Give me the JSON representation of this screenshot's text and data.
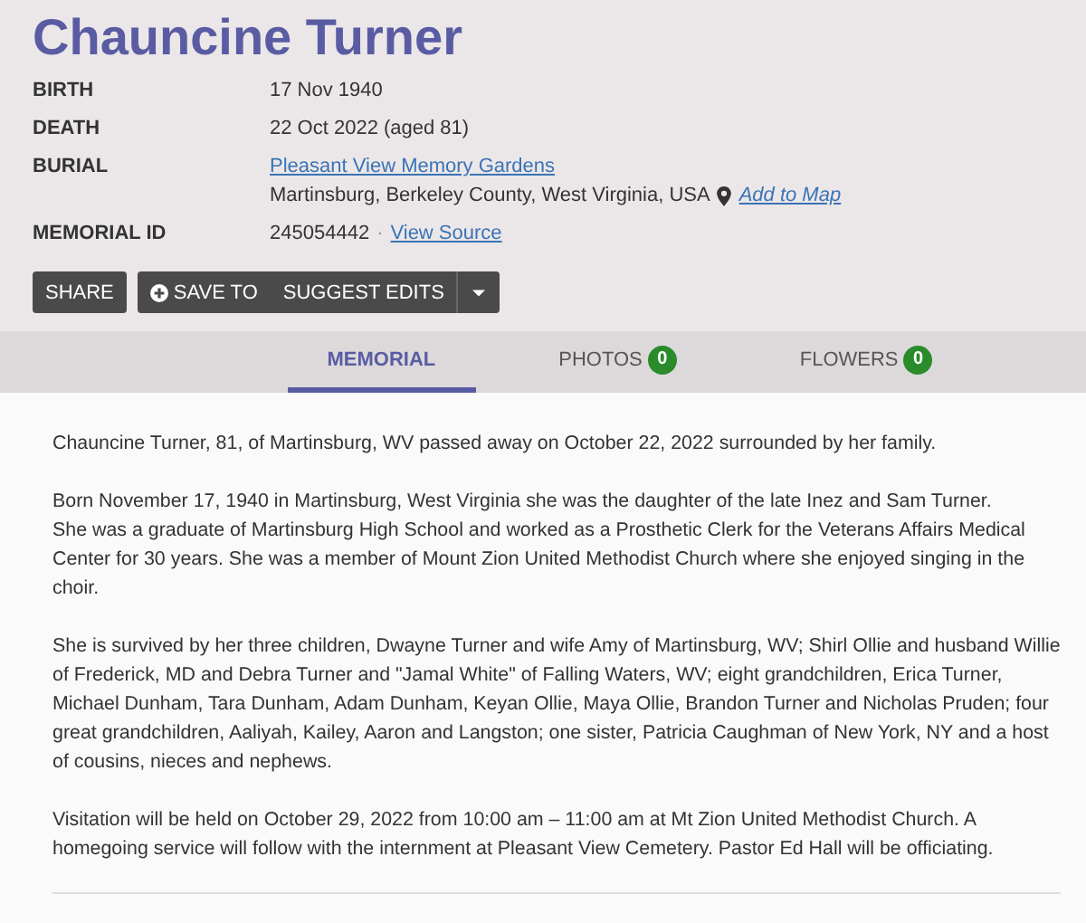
{
  "name": "Chauncine Turner",
  "facts": [
    {
      "label": "BIRTH",
      "value": "17 Nov 1940"
    },
    {
      "label": "DEATH",
      "value": "22 Oct 2022 (aged 81)"
    },
    {
      "label": "BURIAL",
      "link": "Pleasant View Memory Gardens",
      "value": "Martinsburg, Berkeley County, West Virginia, USA",
      "map_link": "Add to Map"
    },
    {
      "label": "MEMORIAL ID",
      "value": "245054442",
      "separator": "·",
      "source_link": "View Source"
    }
  ],
  "actions": [
    {
      "kind": "button",
      "label": "SHARE"
    },
    {
      "kind": "group",
      "items": [
        "SAVE TO",
        "SUGGEST EDITS"
      ]
    }
  ],
  "tabs": [
    {
      "label": "MEMORIAL",
      "selected": true
    },
    {
      "label": "PHOTOS",
      "count": "0",
      "selected": false
    },
    {
      "label": "FLOWERS",
      "count": "0",
      "selected": false
    }
  ],
  "paragraphs": [
    "Chauncine Turner, 81, of Martinsburg, WV passed away on October 22, 2022 surrounded by her family.",
    "Born November 17, 1940 in Martinsburg, West Virginia she was the daughter of the late Inez and Sam Turner.\nShe was a graduate of Martinsburg High School and worked as a Prosthetic Clerk for the Veterans Affairs Medical Center for 30 years. She was a member of Mount Zion United Methodist Church where she enjoyed singing in the choir.",
    "She is survived by her three children, Dwayne Turner and wife Amy of Martinsburg, WV; Shirl Ollie and husband Willie of Frederick, MD and Debra Turner and \"Jamal White\" of Falling Waters, WV; eight grandchildren, Erica Turner, Michael Dunham, Tara Dunham, Adam Dunham, Keyan Ollie, Maya Ollie, Brandon Turner and Nicholas Pruden; four great grandchildren, Aaliyah, Kailey, Aaron and Langston; one sister, Patricia Caughman of New York, NY and a host of cousins, nieces and nephews.",
    "Visitation will be held on October 29, 2022 from 10:00 am – 11:00 am at Mt Zion United Methodist Church. A homegoing service will follow with the internment at Pleasant View Cemetery. Pastor Ed Hall will be officiating."
  ]
}
